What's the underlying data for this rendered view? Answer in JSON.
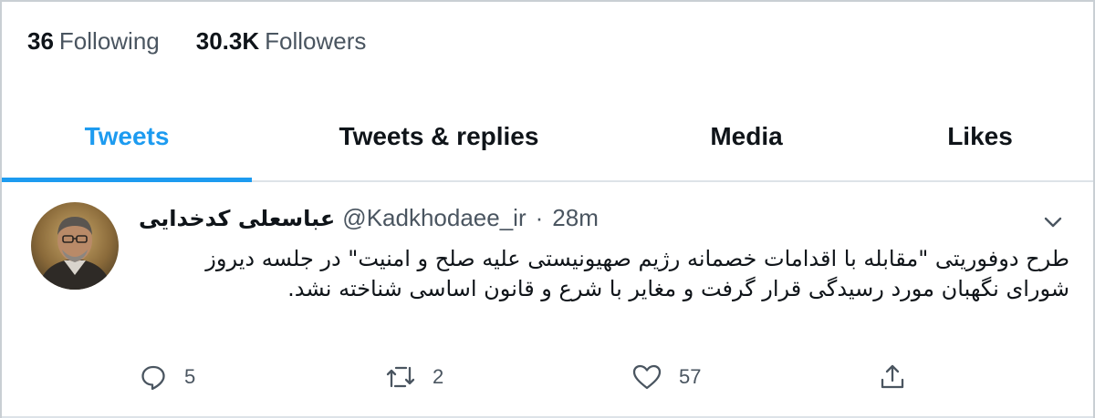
{
  "profile": {
    "following_count": "36",
    "following_label": "Following",
    "followers_count": "30.3K",
    "followers_label": "Followers"
  },
  "tabs": [
    {
      "label": "Tweets",
      "active": true
    },
    {
      "label": "Tweets & replies",
      "active": false
    },
    {
      "label": "Media",
      "active": false
    },
    {
      "label": "Likes",
      "active": false
    }
  ],
  "tweet": {
    "author_name": "عباسعلی کدخدایی",
    "handle": "@Kadkhodaee_ir",
    "separator": "·",
    "time": "28m",
    "text": "طرح دوفوریتی \"مقابله با اقدامات خصمانه رژیم صهیونیستی علیه صلح و امنیت\" در جلسه دیروز شورای نگهبان مورد رسیدگی قرار گرفت و مغایر با شرع و قانون اساسی شناخته نشد.",
    "actions": {
      "reply_count": "5",
      "retweet_count": "2",
      "like_count": "57"
    },
    "icons": {
      "reply": "reply-icon",
      "retweet": "retweet-icon",
      "like": "heart-icon",
      "share": "share-icon",
      "more": "chevron-down-icon"
    }
  },
  "colors": {
    "accent": "#1d9bf0",
    "text_primary": "#0f1419",
    "text_secondary": "#4a5560",
    "divider": "#dde3e8"
  }
}
